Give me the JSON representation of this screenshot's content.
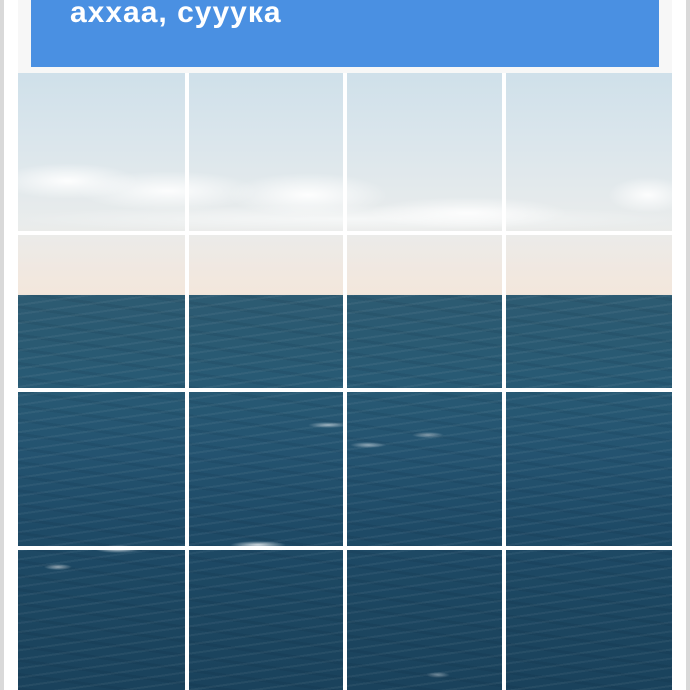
{
  "banner": {
    "title": "аххаа, сууука",
    "color": "#4a90e2"
  },
  "grid": {
    "rows": 4,
    "columns": 4,
    "tiles": [
      {
        "id": "tile-1-1"
      },
      {
        "id": "tile-1-2"
      },
      {
        "id": "tile-1-3"
      },
      {
        "id": "tile-1-4"
      },
      {
        "id": "tile-2-1"
      },
      {
        "id": "tile-2-2"
      },
      {
        "id": "tile-2-3"
      },
      {
        "id": "tile-2-4"
      },
      {
        "id": "tile-3-1"
      },
      {
        "id": "tile-3-2"
      },
      {
        "id": "tile-3-3"
      },
      {
        "id": "tile-3-4"
      },
      {
        "id": "tile-4-1"
      },
      {
        "id": "tile-4-2"
      },
      {
        "id": "tile-4-3"
      },
      {
        "id": "tile-4-4"
      }
    ],
    "image_subject": "sea-horizon-photo"
  }
}
